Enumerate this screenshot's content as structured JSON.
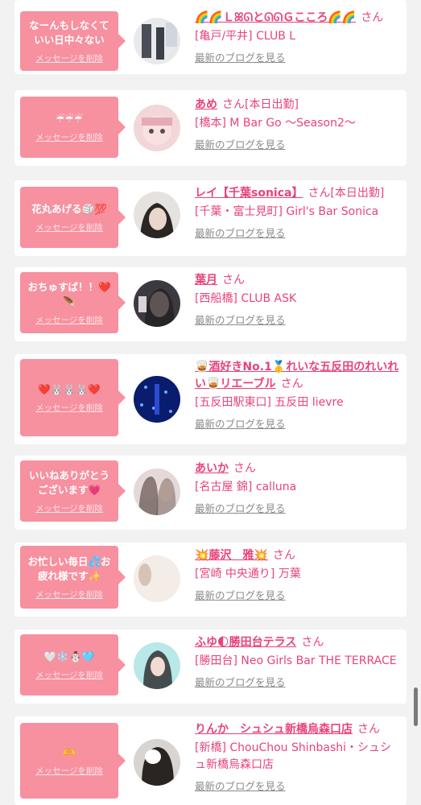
{
  "delete_label": "メッセージを削除",
  "blog_label": "最新のブログを見る",
  "san_label": "さん",
  "accent_color": "#e8437a",
  "bubble_color": "#f7909f",
  "items": [
    {
      "message": "なーんもしなくていい日中々ない",
      "name": "🌈🌈ＬꕤᘏとᘏᘏＧこころ🌈🌈",
      "status": "",
      "shop": "[亀戸/平井] CLUB L"
    },
    {
      "message": "☔☔☔",
      "name": "あめ",
      "status": "[本日出勤]",
      "shop": "[橋本] M Bar Go 〜Season2〜"
    },
    {
      "message": "花丸あげる🏐💯",
      "name": "レイ【千葉sonica】",
      "status": "[本日出勤]",
      "shop": "[千葉・富士見町] Girl's Bar Sonica"
    },
    {
      "message": "おちゅすば！！❤️🪶",
      "name": "葉月",
      "status": "",
      "shop": "[西船橋] CLUB ASK"
    },
    {
      "message": "❤️🐰🐰🐰❤️",
      "name": "🥃酒好きNo.1🥇れいな五反田のれいれい🥃リエーブル",
      "status": "",
      "shop": "[五反田駅東口] 五反田 lievre"
    },
    {
      "message": "いいねありがとうございます💗",
      "name": "あいか",
      "status": "",
      "shop": "[名古屋 錦] calluna"
    },
    {
      "message": "お忙しい毎日💦お疲れ様です✨",
      "name": "💥藤沢　雅💥",
      "status": "",
      "shop": "[宮崎 中央通り] 万葉"
    },
    {
      "message": "🤍❄️⛄🩵",
      "name": "ふゆ🌓勝田台テラス",
      "status": "",
      "shop": "[勝田台] Neo Girls Bar THE TERRACE"
    },
    {
      "message": "🫶",
      "name": "りんか　シュシュ新橋烏森口店",
      "status": "",
      "shop": "[新橋] ChouChou Shinbashi・シュシュ新橋烏森口店"
    }
  ]
}
